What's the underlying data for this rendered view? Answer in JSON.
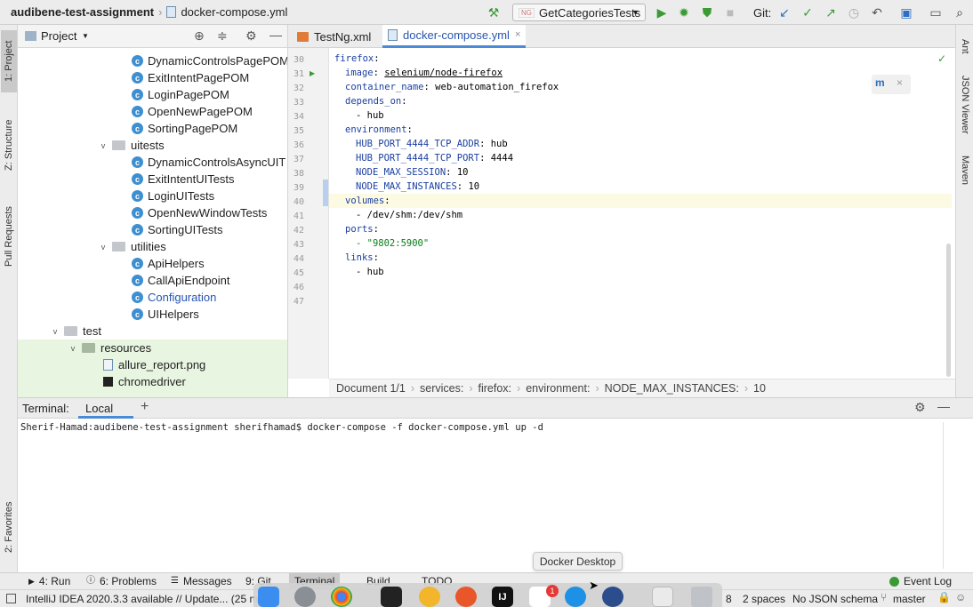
{
  "nav": {
    "project": "audibene-test-assignment",
    "file": "docker-compose.yml",
    "run_config": "GetCategoriesTests",
    "run_config_badge": "NG",
    "git_label": "Git:"
  },
  "left_tabs": {
    "project": "1: Project",
    "structure": "Z: Structure",
    "pull_requests": "Pull Requests",
    "favorites": "2: Favorites"
  },
  "right_tabs": {
    "ant": "Ant",
    "json_viewer": "JSON Viewer",
    "maven": "Maven"
  },
  "project_panel": {
    "title": "Project",
    "items": [
      {
        "label": "DynamicControlsPagePOM",
        "type": "class"
      },
      {
        "label": "ExitIntentPagePOM",
        "type": "class"
      },
      {
        "label": "LoginPagePOM",
        "type": "class"
      },
      {
        "label": "OpenNewPagePOM",
        "type": "class"
      },
      {
        "label": "SortingPagePOM",
        "type": "class"
      },
      {
        "label": "uitests",
        "type": "folder"
      },
      {
        "label": "DynamicControlsAsyncUIT",
        "type": "class"
      },
      {
        "label": "ExitIntentUITests",
        "type": "class"
      },
      {
        "label": "LoginUITests",
        "type": "class"
      },
      {
        "label": "OpenNewWindowTests",
        "type": "class"
      },
      {
        "label": "SortingUITests",
        "type": "class"
      },
      {
        "label": "utilities",
        "type": "folder"
      },
      {
        "label": "ApiHelpers",
        "type": "class"
      },
      {
        "label": "CallApiEndpoint",
        "type": "class"
      },
      {
        "label": "Configuration",
        "type": "class"
      },
      {
        "label": "UIHelpers",
        "type": "class"
      },
      {
        "label": "test",
        "type": "folder"
      },
      {
        "label": "resources",
        "type": "folder"
      },
      {
        "label": "allure_report.png",
        "type": "file"
      },
      {
        "label": "chromedriver",
        "type": "binary"
      }
    ]
  },
  "editor": {
    "tabs": [
      {
        "label": "TestNg.xml"
      },
      {
        "label": "docker-compose.yml"
      }
    ],
    "lines": [
      {
        "num": "30"
      },
      {
        "num": "31",
        "key": "firefox",
        "indent": ""
      },
      {
        "num": "32",
        "key": "image",
        "value": "selenium/node-firefox",
        "indent": "  "
      },
      {
        "num": "33",
        "key": "container_name",
        "value": "web-automation_firefox",
        "indent": "  "
      },
      {
        "num": "34",
        "key": "depends_on",
        "indent": "  "
      },
      {
        "num": "35",
        "value": "- hub",
        "indent": "    "
      },
      {
        "num": "36",
        "key": "environment",
        "indent": "  "
      },
      {
        "num": "37",
        "key": "HUB_PORT_4444_TCP_ADDR",
        "value": "hub",
        "indent": "    "
      },
      {
        "num": "38",
        "key": "HUB_PORT_4444_TCP_PORT",
        "value": "4444",
        "indent": "    "
      },
      {
        "num": "39",
        "key": "NODE_MAX_SESSION",
        "value": "10",
        "indent": "    "
      },
      {
        "num": "40",
        "key": "NODE_MAX_INSTANCES",
        "value": "10",
        "indent": "    "
      },
      {
        "num": "41",
        "key": "volumes",
        "indent": "  "
      },
      {
        "num": "42",
        "value": "- /dev/shm:/dev/shm",
        "indent": "    "
      },
      {
        "num": "43",
        "key": "ports",
        "indent": "  "
      },
      {
        "num": "44",
        "value": "- \"9802:5900\"",
        "indent": "    "
      },
      {
        "num": "45",
        "key": "links",
        "indent": "  "
      },
      {
        "num": "46",
        "value": "- hub",
        "indent": "    "
      },
      {
        "num": "47"
      }
    ],
    "breadcrumb": [
      "Document 1/1",
      "services:",
      "firefox:",
      "environment:",
      "NODE_MAX_INSTANCES:",
      "10"
    ]
  },
  "terminal": {
    "title": "Terminal:",
    "tab": "Local",
    "command": "Sherif-Hamad:audibene-test-assignment sherifhamad$ docker-compose -f docker-compose.yml up -d"
  },
  "bottom_tools": [
    {
      "label": "4: Run"
    },
    {
      "label": "6: Problems"
    },
    {
      "label": "Messages"
    },
    {
      "label": "9: Git"
    },
    {
      "label": "Terminal"
    },
    {
      "label": "Build"
    },
    {
      "label": "TODO"
    },
    {
      "label": "Event Log"
    }
  ],
  "status": {
    "message": "IntelliJ IDEA 2020.3.3 available // Update... (25 m",
    "position": "8",
    "indent": "2 spaces",
    "schema": "No JSON schema",
    "branch": "master"
  },
  "dock": {
    "tooltip": "Docker Desktop",
    "slack_badge": "1",
    "intellij_label": "IJ"
  }
}
